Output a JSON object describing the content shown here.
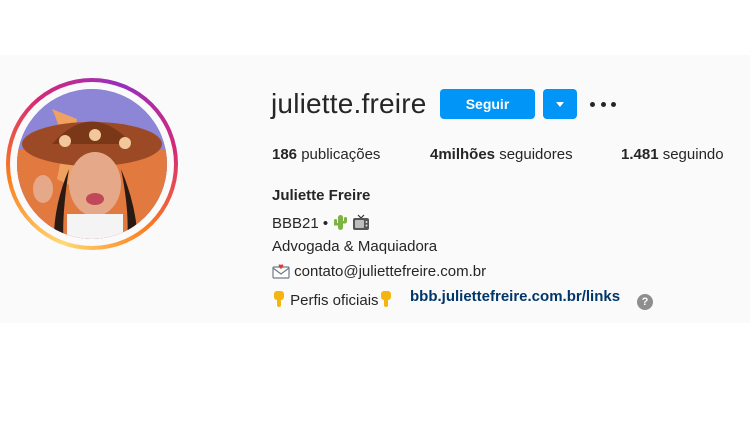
{
  "profile": {
    "username": "juliette.freire",
    "follow_label": "Seguir",
    "full_name": "Juliette Freire"
  },
  "stats": {
    "posts_count": "186",
    "posts_label": " publicações",
    "followers_count": "4milhões",
    "followers_label": " seguidores",
    "following_count": "1.481",
    "following_label": " seguindo"
  },
  "bio": {
    "line1": "BBB21 •",
    "line2": "Advogada & Maquiadora",
    "line3": "contato@juliettefreire.com.br",
    "line4": "Perfis oficiais",
    "link": "bbb.juliettefreire.com.br/links",
    "help": "?"
  },
  "colors": {
    "accent": "#0095f6",
    "link": "#00376b"
  },
  "icons": [
    "chevron-down-icon",
    "more-options-icon",
    "cactus-icon",
    "tv-icon",
    "envelope-icon",
    "pointing-down-icon",
    "help-icon"
  ]
}
